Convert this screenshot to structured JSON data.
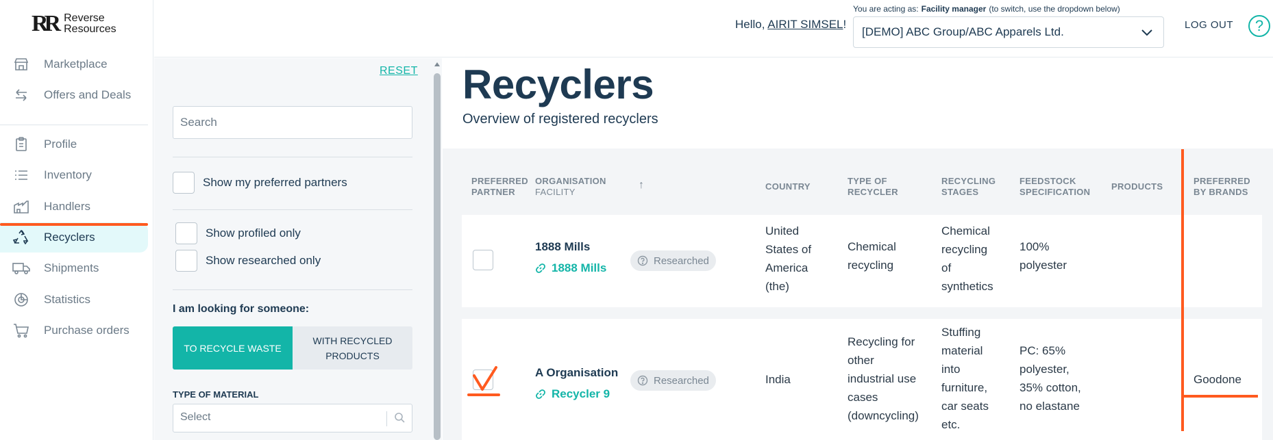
{
  "brand": {
    "mark": "RR",
    "line1": "Reverse",
    "line2": "Resources"
  },
  "nav": [
    {
      "label": "Marketplace",
      "icon": "store-icon"
    },
    {
      "label": "Offers and Deals",
      "icon": "arrows-swap-icon"
    },
    {
      "label": "Profile",
      "icon": "clipboard-icon"
    },
    {
      "label": "Inventory",
      "icon": "list-icon"
    },
    {
      "label": "Handlers",
      "icon": "factory-icon"
    },
    {
      "label": "Recyclers",
      "icon": "recycle-icon"
    },
    {
      "label": "Shipments",
      "icon": "truck-icon"
    },
    {
      "label": "Statistics",
      "icon": "pie-chart-icon"
    },
    {
      "label": "Purchase orders",
      "icon": "cart-icon"
    }
  ],
  "header": {
    "hello_prefix": "Hello,",
    "user_name": "AIRIT SIMSEL",
    "hello_suffix": "!",
    "acting_prefix": "You are acting as:",
    "acting_role": "Facility manager",
    "acting_hint": "(to switch, use the dropdown below)",
    "org_selected": "[DEMO] ABC Group/ABC Apparels Ltd.",
    "logout": "LOG OUT",
    "help": "?"
  },
  "filters": {
    "reset": "RESET",
    "search_placeholder": "Search",
    "preferred_partners": "Show my preferred partners",
    "profiled_only": "Show profiled only",
    "researched_only": "Show researched only",
    "looking_for": "I am looking for someone:",
    "seg_recycle": "TO RECYCLE WASTE",
    "seg_products_1": "WITH RECYCLED",
    "seg_products_2": "PRODUCTS",
    "material_label": "TYPE OF MATERIAL",
    "material_placeholder": "Select"
  },
  "page": {
    "title": "Recyclers",
    "subtitle": "Overview of registered recyclers"
  },
  "table": {
    "headers": {
      "preferred_1": "PREFERRED",
      "preferred_2": "PARTNER",
      "org_1": "ORGANISATION",
      "org_2": "FACILITY",
      "sort": "↑",
      "country": "COUNTRY",
      "type_1": "TYPE OF",
      "type_2": "RECYCLER",
      "stages_1": "RECYCLING",
      "stages_2": "STAGES",
      "feed_1": "FEEDSTOCK",
      "feed_2": "SPECIFICATION",
      "products": "PRODUCTS",
      "brands_1": "PREFERRED",
      "brands_2": "BY BRANDS"
    },
    "rows": [
      {
        "org": "1888 Mills",
        "facility": "1888 Mills",
        "badge": "Researched",
        "country": [
          "United",
          "States of",
          "America",
          "(the)"
        ],
        "type": [
          "Chemical",
          "recycling"
        ],
        "stages": [
          "Chemical",
          "recycling",
          "of",
          "synthetics"
        ],
        "feed": [
          "100%",
          "polyester"
        ],
        "products": "",
        "brands": ""
      },
      {
        "org": "A Organisation",
        "facility": "Recycler 9",
        "badge": "Researched",
        "country": [
          "India"
        ],
        "type": [
          "Recycling for",
          "other",
          "industrial use",
          "cases",
          "(downcycling)"
        ],
        "stages": [
          "Stuffing",
          "material",
          "into",
          "furniture,",
          "car seats",
          "etc."
        ],
        "feed": [
          "PC: 65%",
          "polyester,",
          "35% cotton,",
          "no elastane"
        ],
        "products": "",
        "brands": "Goodone"
      }
    ]
  },
  "colors": {
    "accent": "#13b5a8",
    "navy": "#1e3a52",
    "annotation": "#ff5a1f"
  }
}
